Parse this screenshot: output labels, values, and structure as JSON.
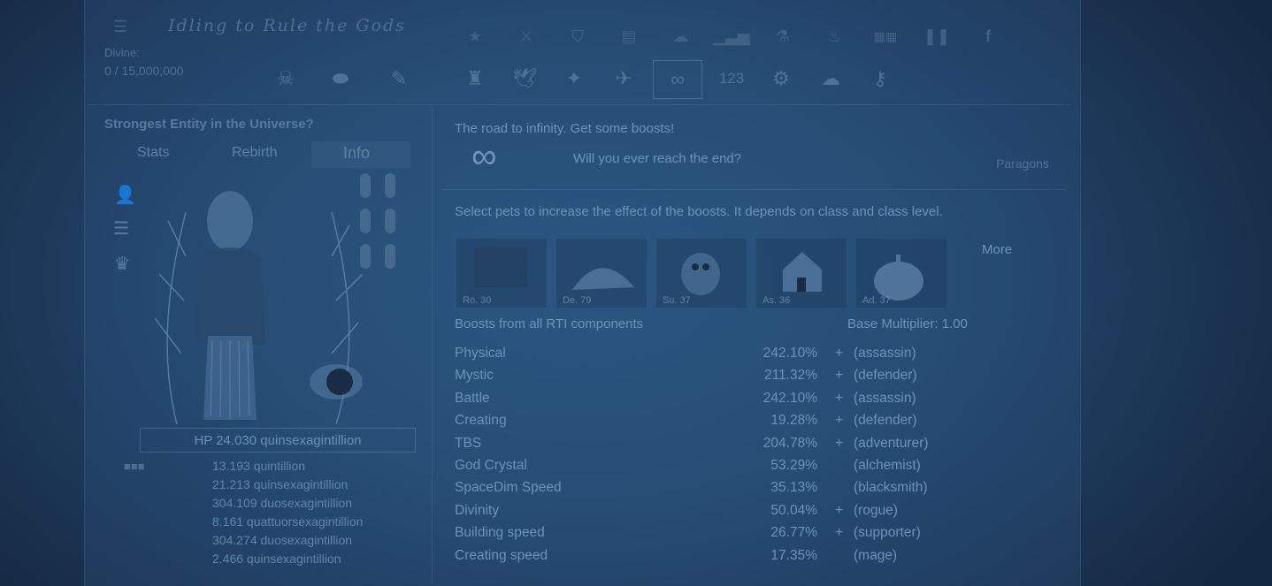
{
  "header": {
    "title": "Idling to Rule the Gods",
    "divine_label": "Divine:",
    "divine_value": "0 / 15,000,000"
  },
  "top_icons_row1": [
    "star-icon",
    "sword-icon",
    "shield-icon",
    "document-icon",
    "cloud-icon",
    "bar-chart-icon",
    "flask-icon",
    "flame-icon",
    "ccs-icon",
    "pause-icon",
    "facebook-icon"
  ],
  "top_icons_row2": [
    "castle-icon",
    "bird-icon",
    "dragon-icon",
    "plane-icon",
    "infinity-tab-icon",
    "numbers-icon",
    "gear-icon",
    "cloud-upload-icon",
    "key-icon"
  ],
  "top_icons_row2_labels": {
    "numbers": "123"
  },
  "left_small_icons": [
    "skull-icon",
    "stone-icon",
    "scroll-icon"
  ],
  "left_panel": {
    "title": "Strongest Entity in the Universe?",
    "tabs": [
      "Stats",
      "Rebirth",
      "Info"
    ],
    "active_tab": "Info",
    "hp": "HP 24.030 quinsexagintillion",
    "stats": [
      "13.193 quintillion",
      "21.213 quinsexagintillion",
      "304.109 duosexagintillion",
      "8.161 quattuorsexagintillion",
      "304.274 duosexagintillion",
      "2.466 quinsexagintillion"
    ]
  },
  "main": {
    "heading": "The road to infinity. Get some boosts!",
    "subheading": "Will you ever reach the end?",
    "paragons_label": "Paragons",
    "pets_description": "Select pets to increase the effect of the boosts. It depends on class and class level.",
    "more_label": "More",
    "pets": [
      {
        "name": "Ro. 30",
        "icon": "rock-pet-icon"
      },
      {
        "name": "De. 79",
        "icon": "armadillo-pet-icon"
      },
      {
        "name": "Su. 37",
        "icon": "raccoon-pet-icon"
      },
      {
        "name": "As. 36",
        "icon": "house-pet-icon"
      },
      {
        "name": "Ad. 37",
        "icon": "pumpkin-pet-icon"
      }
    ],
    "boosts_title": "Boosts from all RTI components",
    "base_multiplier": "Base Multiplier: 1.00",
    "boosts": [
      {
        "name": "Physical",
        "value": "242.10%",
        "plus": "+",
        "class": "(assassin)"
      },
      {
        "name": "Mystic",
        "value": "211.32%",
        "plus": "+",
        "class": "(defender)"
      },
      {
        "name": "Battle",
        "value": "242.10%",
        "plus": "+",
        "class": "(assassin)"
      },
      {
        "name": "Creating",
        "value": "19.28%",
        "plus": "+",
        "class": "(defender)"
      },
      {
        "name": "TBS",
        "value": "204.78%",
        "plus": "+",
        "class": "(adventurer)"
      },
      {
        "name": "God Crystal",
        "value": "53.29%",
        "plus": "",
        "class": "(alchemist)"
      },
      {
        "name": "SpaceDim Speed",
        "value": "35.13%",
        "plus": "",
        "class": "(blacksmith)"
      },
      {
        "name": "Divinity",
        "value": "50.04%",
        "plus": "+",
        "class": "(rogue)"
      },
      {
        "name": "Building speed",
        "value": "26.77%",
        "plus": "+",
        "class": "(supporter)"
      },
      {
        "name": "Creating speed",
        "value": "17.35%",
        "plus": "",
        "class": "(mage)"
      }
    ]
  }
}
